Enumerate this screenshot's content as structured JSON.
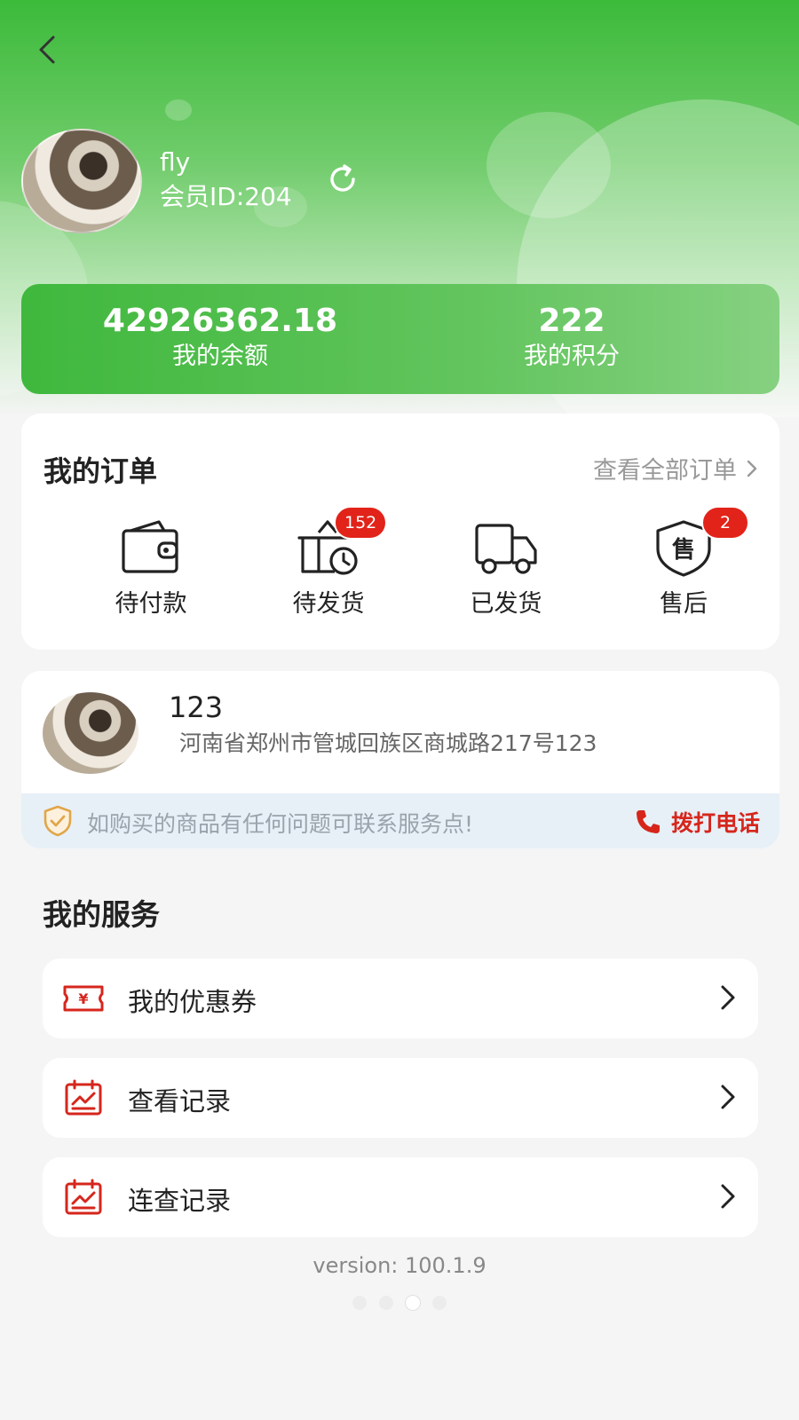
{
  "header": {
    "user_name": "fly",
    "member_id": "会员ID:204"
  },
  "stats": {
    "balance_value": "42926362.18",
    "balance_label": "我的余额",
    "points_value": "222",
    "points_label": "我的积分"
  },
  "orders": {
    "title": "我的订单",
    "view_all": "查看全部订单",
    "items": [
      {
        "label": "待付款",
        "icon": "wallet-icon"
      },
      {
        "label": "待发货",
        "icon": "box-clock-icon",
        "badge": "152"
      },
      {
        "label": "已发货",
        "icon": "truck-icon"
      },
      {
        "label": "售后",
        "icon": "after-sales-shield-icon",
        "icon_text": "售",
        "badge": "2"
      }
    ]
  },
  "store": {
    "name": "123",
    "address": "河南省郑州市管城回族区商城路217号123",
    "notice": "如购买的商品有任何问题可联系服务点!",
    "call_label": "拨打电话"
  },
  "services": {
    "title": "我的服务",
    "items": [
      {
        "label": "我的优惠券",
        "icon": "coupon-icon",
        "icon_text": "¥"
      },
      {
        "label": "查看记录",
        "icon": "record-calendar-icon"
      },
      {
        "label": "连查记录",
        "icon": "record-calendar-icon"
      }
    ]
  },
  "version": "version: 100.1.9",
  "pager": {
    "count": 4,
    "active": 3
  },
  "colors": {
    "brand_green": "#3cba3a",
    "accent_red": "#e2231a"
  }
}
